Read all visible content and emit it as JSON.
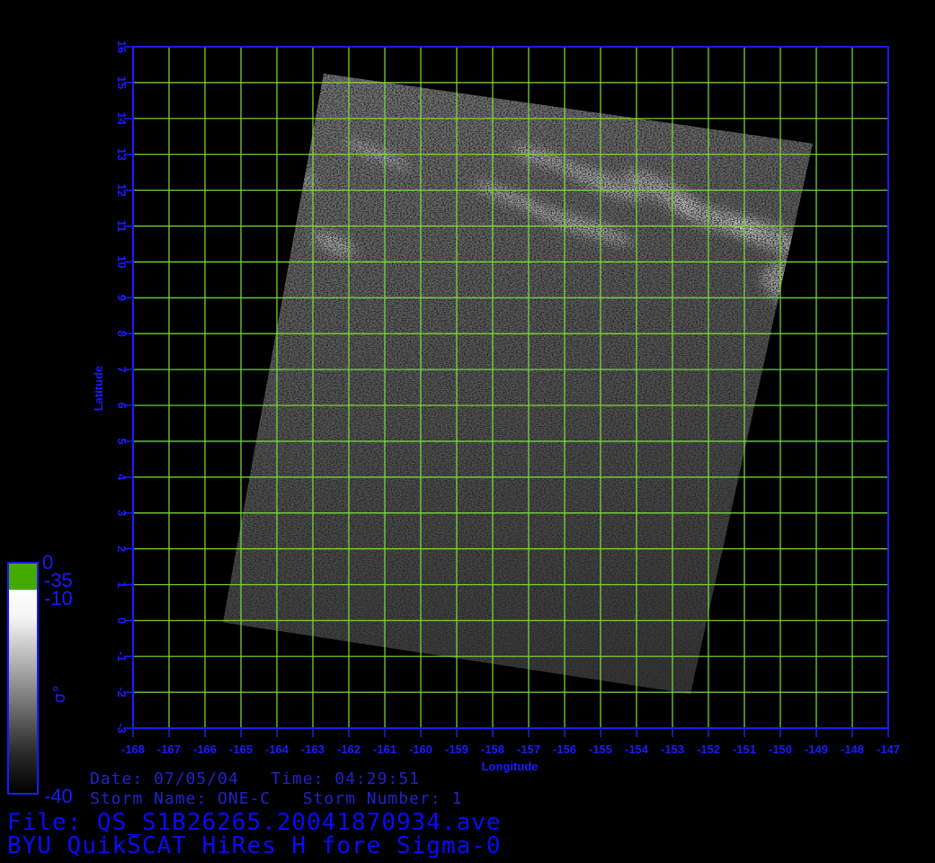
{
  "chart_data": {
    "type": "heatmap",
    "xlabel": "Longitude",
    "ylabel": "Latitude",
    "xlim": [
      -168,
      -147
    ],
    "ylim": [
      -3,
      16
    ],
    "xticks": [
      -168,
      -167,
      -166,
      -165,
      -164,
      -163,
      -162,
      -161,
      -160,
      -159,
      -158,
      -157,
      -156,
      -155,
      -154,
      -153,
      -152,
      -151,
      -150,
      -149,
      -148,
      -147
    ],
    "yticks": [
      -3,
      -2,
      -1,
      0,
      1,
      2,
      3,
      4,
      5,
      6,
      7,
      8,
      9,
      10,
      11,
      12,
      13,
      14,
      15,
      16
    ],
    "grid": true,
    "swath_corners": [
      {
        "lon": -162.7,
        "lat": 15.25
      },
      {
        "lon": -149.1,
        "lat": 13.3
      },
      {
        "lon": -152.5,
        "lat": -2.05
      },
      {
        "lon": -165.5,
        "lat": -0.05
      }
    ],
    "colorbar": {
      "label": "σ°",
      "tick_labels": [
        "0",
        "-35",
        "-10",
        "-40"
      ],
      "land_color": "#44aa00"
    },
    "colors": {
      "axis": "#1a1aff",
      "grid": "#7ee03a",
      "background": "#000000"
    }
  },
  "info": {
    "date_line": "Date: 07/05/04   Time: 04:29:51",
    "storm_line": "Storm Name: ONE-C   Storm Number: 1",
    "file_line": "File: QS_S1B26265.20041870934.ave",
    "title_line": "BYU QuikSCAT HiRes H fore Sigma-0"
  }
}
